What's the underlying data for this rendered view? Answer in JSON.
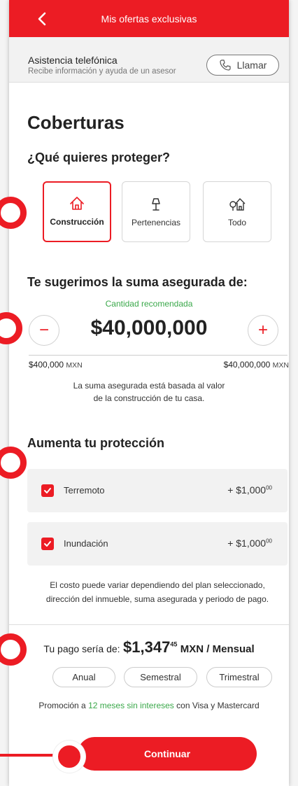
{
  "header": {
    "title": "Mis ofertas exclusivas",
    "back_icon": "chevron-left-icon"
  },
  "assist": {
    "title": "Asistencia telefónica",
    "subtitle": "Recibe información y ayuda de un asesor",
    "call_label": "Llamar",
    "call_icon": "phone-icon"
  },
  "coverage": {
    "heading": "Coberturas",
    "question": "¿Qué quieres proteger?",
    "options": [
      {
        "label": "Construcción",
        "icon": "house-icon",
        "selected": true
      },
      {
        "label": "Pertenencias",
        "icon": "lamp-icon",
        "selected": false
      },
      {
        "label": "Todo",
        "icon": "house-tree-icon",
        "selected": false
      }
    ]
  },
  "suggested": {
    "heading": "Te sugerimos la suma asegurada de:",
    "recommended_label": "Cantidad recomendada",
    "amount": "$40,000,000",
    "min_value": "$400,000",
    "max_value": "$40,000,000",
    "currency": "MXN",
    "note_line1": "La suma asegurada está basada al valor",
    "note_line2": "de la construcción de tu casa."
  },
  "extras": {
    "heading": "Aumenta tu protección",
    "items": [
      {
        "name": "Terremoto",
        "price": "+ $1,000",
        "cents": "00",
        "checked": true
      },
      {
        "name": "Inundación",
        "price": "+ $1,000",
        "cents": "00",
        "checked": true
      }
    ],
    "note_line1": "El costo puede variar dependiendo del plan seleccionado,",
    "note_line2": "dirección del inmueble, suma asegurada y periodo de pago."
  },
  "payment": {
    "label": "Tu pago sería de:",
    "value": "$1,347",
    "cents": "45",
    "currency_period": "MXN / Mensual",
    "frequencies": [
      "Anual",
      "Semestral",
      "Trimestral"
    ]
  },
  "promo": {
    "prefix": "Promoción a",
    "highlight": "12 meses sin intereses",
    "suffix": "con Visa y Mastercard"
  },
  "cta": {
    "label": "Continuar"
  },
  "colors": {
    "brand": "#ec1c24",
    "accent_green": "#3aa84a"
  }
}
